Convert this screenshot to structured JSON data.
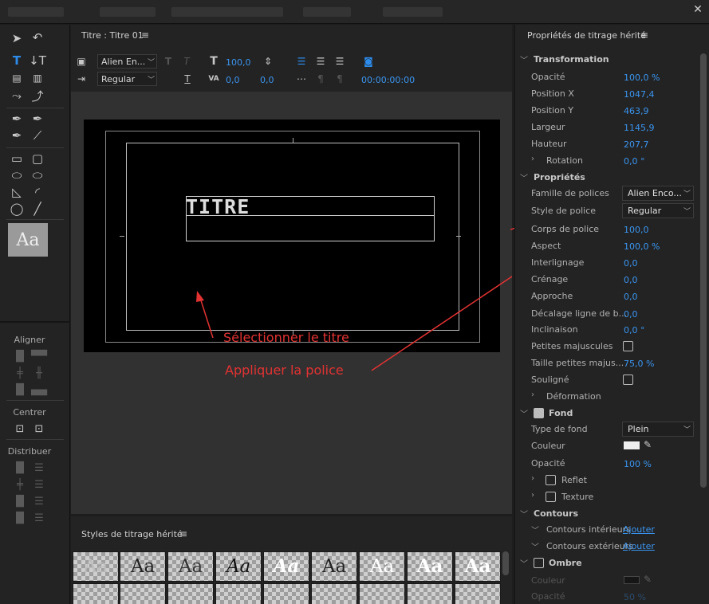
{
  "title_panel": {
    "tab_title": "Titre : Titre 01",
    "toolbar": {
      "font_family": "Alien En...",
      "font_style": "Regular",
      "font_size": "100,0",
      "kerning": "0,0",
      "leading": "0,0",
      "timecode": "00:00:00:00"
    },
    "canvas": {
      "title_text": "TITRE",
      "annotation_select": "Sélectionner le titre",
      "annotation_apply": "Appliquer la police"
    }
  },
  "tools": {
    "preview_label": "Aa",
    "align_label": "Aligner",
    "center_label": "Centrer",
    "distribute_label": "Distribuer"
  },
  "styles_panel": {
    "title": "Styles de titrage hérité",
    "swatches": [
      "Aa",
      "Aa",
      "Aa",
      "Aa",
      "Aa",
      "Aa",
      "Aa",
      "Aa",
      "Aa"
    ]
  },
  "properties": {
    "title": "Propriétés de titrage hérité",
    "transformation": {
      "label": "Transformation",
      "opacity_label": "Opacité",
      "opacity": "100,0 %",
      "posx_label": "Position X",
      "posx": "1047,4",
      "posy_label": "Position Y",
      "posy": "463,9",
      "width_label": "Largeur",
      "width": "1145,9",
      "height_label": "Hauteur",
      "height": "207,7",
      "rotation_label": "Rotation",
      "rotation": "0,0 °"
    },
    "properties_section": {
      "label": "Propriétés",
      "font_family_label": "Famille de polices",
      "font_family": "Alien Enco...",
      "font_style_label": "Style de police",
      "font_style": "Regular",
      "font_size_label": "Corps de police",
      "font_size": "100,0",
      "aspect_label": "Aspect",
      "aspect": "100,0 %",
      "leading_label": "Interlignage",
      "leading": "0,0",
      "kerning_label": "Crénage",
      "kerning": "0,0",
      "tracking_label": "Approche",
      "tracking": "0,0",
      "baseline_label": "Décalage ligne de b...",
      "baseline": "0,0",
      "slant_label": "Inclinaison",
      "slant": "0,0 °",
      "smallcaps_label": "Petites majuscules",
      "smallcaps_size_label": "Taille petites majus...",
      "smallcaps_size": "75,0 %",
      "underline_label": "Souligné",
      "distort_label": "Déformation"
    },
    "fill": {
      "label": "Fond",
      "type_label": "Type de fond",
      "type": "Plein",
      "color_label": "Couleur",
      "opacity_label": "Opacité",
      "opacity": "100 %",
      "sheen_label": "Reflet",
      "texture_label": "Texture"
    },
    "strokes": {
      "label": "Contours",
      "inner_label": "Contours intérieurs",
      "inner_action": "Ajouter",
      "outer_label": "Contours extérieurs",
      "outer_action": "Ajouter"
    },
    "shadow": {
      "label": "Ombre",
      "color_label": "Couleur",
      "opacity_label": "Opacité",
      "opacity": "50 %"
    }
  },
  "colors": {
    "accent": "#3a95f0",
    "annotation": "#e33232",
    "panel_bg": "#232323",
    "canvas_bg": "#313131"
  }
}
